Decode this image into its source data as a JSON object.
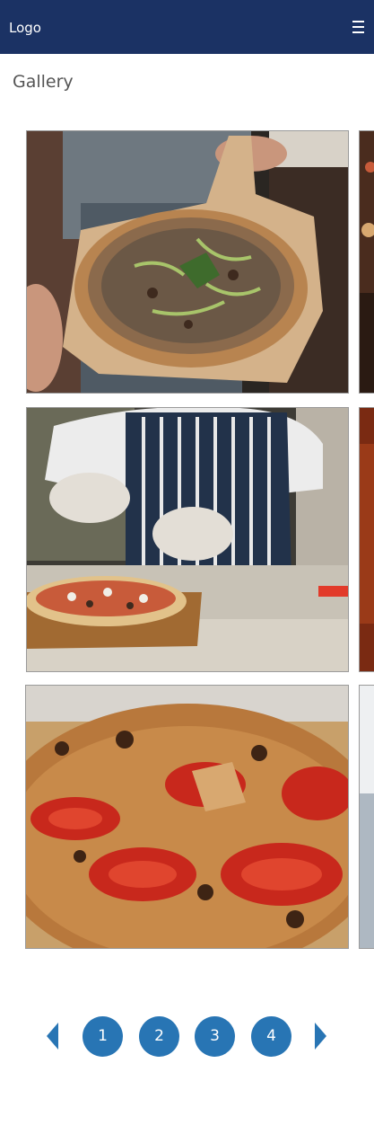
{
  "navbar": {
    "logo": "Logo",
    "menu_icon": "hamburger-menu-icon",
    "background": "#1b3264"
  },
  "page": {
    "title": "Gallery"
  },
  "gallery": {
    "photos": [
      {
        "name": "pizza-on-wooden-peel-photo",
        "description": "pizza on a wooden peel"
      },
      {
        "name": "chef-topping-pizza-photo",
        "description": "chef in striped apron adding toppings"
      },
      {
        "name": "tomato-pizza-closeup-photo",
        "description": "close-up of tomato pizza"
      }
    ]
  },
  "pagination": {
    "prev_icon": "chevron-left-icon",
    "next_icon": "chevron-right-icon",
    "pages": [
      "1",
      "2",
      "3",
      "4"
    ],
    "accent": "#2875b4"
  }
}
